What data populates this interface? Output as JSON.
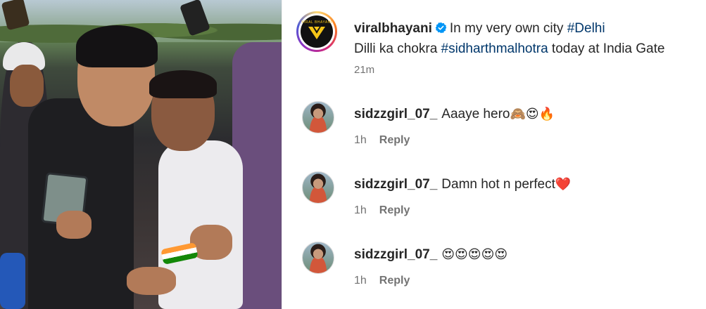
{
  "post": {
    "username": "viralbhayani",
    "avatar_text": "VIRAL BHAYANI",
    "caption_line1_text": "In my very own city ",
    "caption_line1_tag": "#Delhi",
    "caption_line2_pre": "Dilli ka chokra ",
    "caption_line2_tag": "#sidharthmalhotra",
    "caption_line2_post": " today at India Gate",
    "time": "21m",
    "verified_icon": "verified-badge-icon"
  },
  "comments": [
    {
      "username": "sidzzgirl_07_",
      "text": "Aaaye hero",
      "emoji": "🙈😍🔥",
      "time": "1h",
      "reply_label": "Reply"
    },
    {
      "username": "sidzzgirl_07_",
      "text": "Damn hot n perfect",
      "emoji": "❤️",
      "time": "1h",
      "reply_label": "Reply"
    },
    {
      "username": "sidzzgirl_07_",
      "text": "",
      "emoji": "😍😍😍😍😍",
      "time": "1h",
      "reply_label": "Reply"
    }
  ],
  "colors": {
    "hashtag": "#00376b",
    "verified": "#0095f6",
    "muted": "#737373",
    "text": "#262626"
  }
}
